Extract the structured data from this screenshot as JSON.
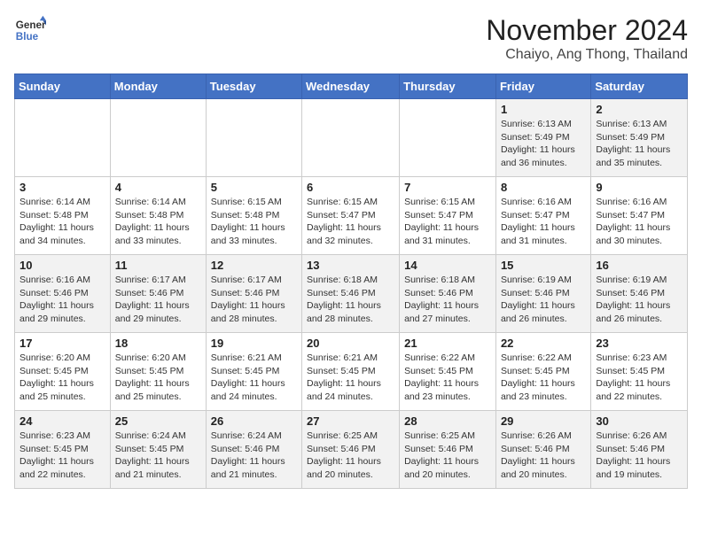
{
  "header": {
    "logo_line1": "General",
    "logo_line2": "Blue",
    "month": "November 2024",
    "location": "Chaiyo, Ang Thong, Thailand"
  },
  "weekdays": [
    "Sunday",
    "Monday",
    "Tuesday",
    "Wednesday",
    "Thursday",
    "Friday",
    "Saturday"
  ],
  "weeks": [
    [
      {
        "day": "",
        "info": ""
      },
      {
        "day": "",
        "info": ""
      },
      {
        "day": "",
        "info": ""
      },
      {
        "day": "",
        "info": ""
      },
      {
        "day": "",
        "info": ""
      },
      {
        "day": "1",
        "info": "Sunrise: 6:13 AM\nSunset: 5:49 PM\nDaylight: 11 hours and 36 minutes."
      },
      {
        "day": "2",
        "info": "Sunrise: 6:13 AM\nSunset: 5:49 PM\nDaylight: 11 hours and 35 minutes."
      }
    ],
    [
      {
        "day": "3",
        "info": "Sunrise: 6:14 AM\nSunset: 5:48 PM\nDaylight: 11 hours and 34 minutes."
      },
      {
        "day": "4",
        "info": "Sunrise: 6:14 AM\nSunset: 5:48 PM\nDaylight: 11 hours and 33 minutes."
      },
      {
        "day": "5",
        "info": "Sunrise: 6:15 AM\nSunset: 5:48 PM\nDaylight: 11 hours and 33 minutes."
      },
      {
        "day": "6",
        "info": "Sunrise: 6:15 AM\nSunset: 5:47 PM\nDaylight: 11 hours and 32 minutes."
      },
      {
        "day": "7",
        "info": "Sunrise: 6:15 AM\nSunset: 5:47 PM\nDaylight: 11 hours and 31 minutes."
      },
      {
        "day": "8",
        "info": "Sunrise: 6:16 AM\nSunset: 5:47 PM\nDaylight: 11 hours and 31 minutes."
      },
      {
        "day": "9",
        "info": "Sunrise: 6:16 AM\nSunset: 5:47 PM\nDaylight: 11 hours and 30 minutes."
      }
    ],
    [
      {
        "day": "10",
        "info": "Sunrise: 6:16 AM\nSunset: 5:46 PM\nDaylight: 11 hours and 29 minutes."
      },
      {
        "day": "11",
        "info": "Sunrise: 6:17 AM\nSunset: 5:46 PM\nDaylight: 11 hours and 29 minutes."
      },
      {
        "day": "12",
        "info": "Sunrise: 6:17 AM\nSunset: 5:46 PM\nDaylight: 11 hours and 28 minutes."
      },
      {
        "day": "13",
        "info": "Sunrise: 6:18 AM\nSunset: 5:46 PM\nDaylight: 11 hours and 28 minutes."
      },
      {
        "day": "14",
        "info": "Sunrise: 6:18 AM\nSunset: 5:46 PM\nDaylight: 11 hours and 27 minutes."
      },
      {
        "day": "15",
        "info": "Sunrise: 6:19 AM\nSunset: 5:46 PM\nDaylight: 11 hours and 26 minutes."
      },
      {
        "day": "16",
        "info": "Sunrise: 6:19 AM\nSunset: 5:46 PM\nDaylight: 11 hours and 26 minutes."
      }
    ],
    [
      {
        "day": "17",
        "info": "Sunrise: 6:20 AM\nSunset: 5:45 PM\nDaylight: 11 hours and 25 minutes."
      },
      {
        "day": "18",
        "info": "Sunrise: 6:20 AM\nSunset: 5:45 PM\nDaylight: 11 hours and 25 minutes."
      },
      {
        "day": "19",
        "info": "Sunrise: 6:21 AM\nSunset: 5:45 PM\nDaylight: 11 hours and 24 minutes."
      },
      {
        "day": "20",
        "info": "Sunrise: 6:21 AM\nSunset: 5:45 PM\nDaylight: 11 hours and 24 minutes."
      },
      {
        "day": "21",
        "info": "Sunrise: 6:22 AM\nSunset: 5:45 PM\nDaylight: 11 hours and 23 minutes."
      },
      {
        "day": "22",
        "info": "Sunrise: 6:22 AM\nSunset: 5:45 PM\nDaylight: 11 hours and 23 minutes."
      },
      {
        "day": "23",
        "info": "Sunrise: 6:23 AM\nSunset: 5:45 PM\nDaylight: 11 hours and 22 minutes."
      }
    ],
    [
      {
        "day": "24",
        "info": "Sunrise: 6:23 AM\nSunset: 5:45 PM\nDaylight: 11 hours and 22 minutes."
      },
      {
        "day": "25",
        "info": "Sunrise: 6:24 AM\nSunset: 5:45 PM\nDaylight: 11 hours and 21 minutes."
      },
      {
        "day": "26",
        "info": "Sunrise: 6:24 AM\nSunset: 5:46 PM\nDaylight: 11 hours and 21 minutes."
      },
      {
        "day": "27",
        "info": "Sunrise: 6:25 AM\nSunset: 5:46 PM\nDaylight: 11 hours and 20 minutes."
      },
      {
        "day": "28",
        "info": "Sunrise: 6:25 AM\nSunset: 5:46 PM\nDaylight: 11 hours and 20 minutes."
      },
      {
        "day": "29",
        "info": "Sunrise: 6:26 AM\nSunset: 5:46 PM\nDaylight: 11 hours and 20 minutes."
      },
      {
        "day": "30",
        "info": "Sunrise: 6:26 AM\nSunset: 5:46 PM\nDaylight: 11 hours and 19 minutes."
      }
    ]
  ]
}
